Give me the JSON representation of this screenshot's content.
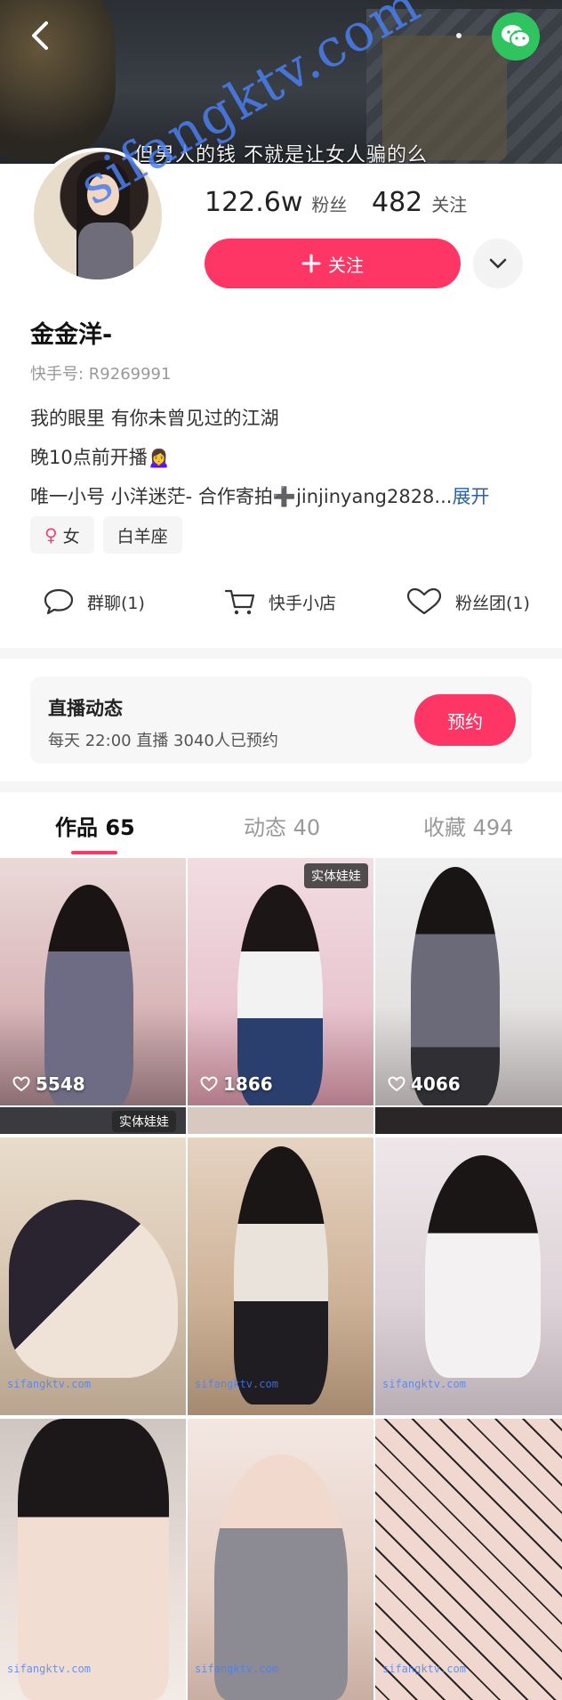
{
  "cover": {
    "caption": "但男人的钱 不就是让女人骗的么"
  },
  "watermark": "sifangktv.com",
  "profile": {
    "followers": {
      "value": "122.6w",
      "label": "粉丝"
    },
    "following": {
      "value": "482",
      "label": "关注"
    },
    "follow_button": "关注",
    "name": "金金洋-",
    "user_id": "快手号: R9269991",
    "bio": [
      "我的眼里 有你未曾见过的江湖",
      "晚10点前开播🙍‍♀️",
      "唯一小号 小洋迷茫- 合作寄拍➕jinjinyang2828..."
    ],
    "bio_expand": "展开",
    "tags": [
      {
        "icon": "female-icon",
        "symbol": "♀",
        "label": "女"
      },
      {
        "label": "白羊座"
      }
    ]
  },
  "shortcuts": [
    {
      "icon": "chat-bubble-icon",
      "label": "群聊(1)"
    },
    {
      "icon": "shopping-cart-icon",
      "label": "快手小店"
    },
    {
      "icon": "heart-outline-icon",
      "label": "粉丝团(1)"
    }
  ],
  "live": {
    "title": "直播动态",
    "subtitle": "每天 22:00 直播 3040人已预约",
    "reserve_button": "预约"
  },
  "tabs": [
    {
      "label": "作品 65",
      "active": true
    },
    {
      "label": "动态 40",
      "active": false
    },
    {
      "label": "收藏 494",
      "active": false
    }
  ],
  "grid": {
    "row1": [
      {
        "likes": "5548",
        "badge": ""
      },
      {
        "likes": "1866",
        "badge": "实体娃娃"
      },
      {
        "likes": "4066",
        "badge": ""
      }
    ],
    "row2_badge": "实体娃娃",
    "tile_watermark": "sifangktv.com"
  },
  "colors": {
    "accent": "#fe3666",
    "wechat": "#2fc45f",
    "watermark": "#4a7ff0",
    "link": "#2b5fa8"
  }
}
